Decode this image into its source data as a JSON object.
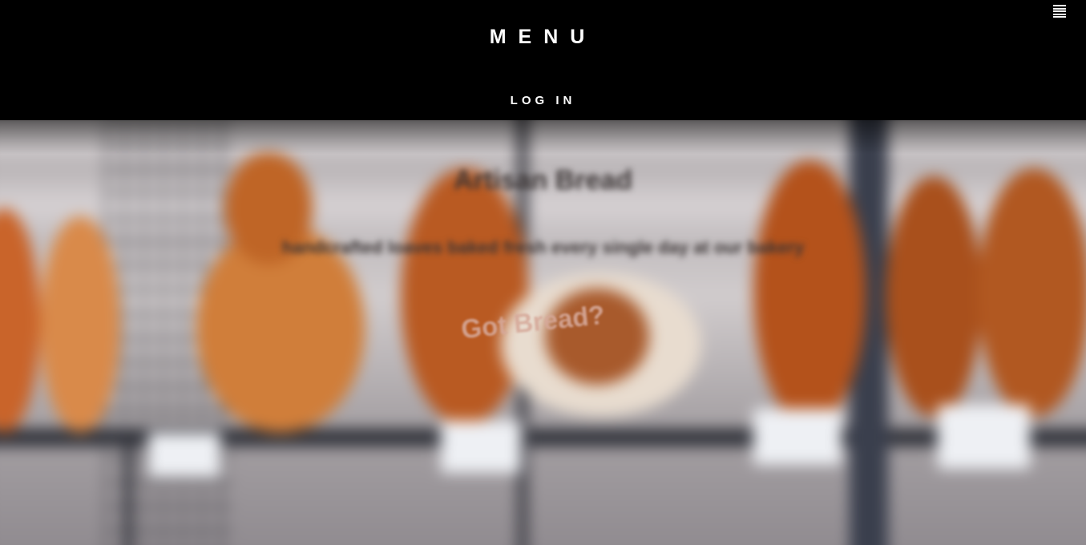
{
  "header": {
    "menu_title": "MENU",
    "login_label": "LOG IN",
    "menu_icon": "hamburger-icon"
  },
  "hero": {
    "heading": "Artisan Bread",
    "subheading": "handcrafted loaves baked fresh every single day at our bakery",
    "tagline": "Got Bread?"
  }
}
